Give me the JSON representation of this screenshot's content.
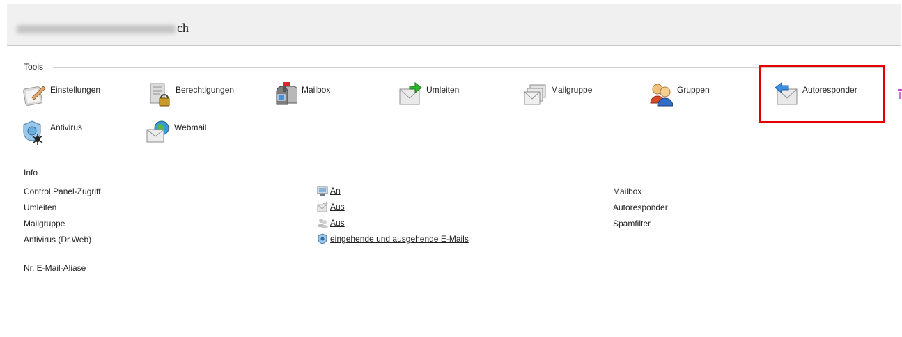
{
  "header": {
    "email_suffix": "ch"
  },
  "tools": {
    "title": "Tools",
    "items": [
      {
        "label": "Einstellungen",
        "icon": "settings-icon"
      },
      {
        "label": "Berechtigungen",
        "icon": "permissions-icon"
      },
      {
        "label": "Mailbox",
        "icon": "mailbox-icon"
      },
      {
        "label": "Umleiten",
        "icon": "forward-mail-icon"
      },
      {
        "label": "Mailgruppe",
        "icon": "mail-group-icon"
      },
      {
        "label": "Gruppen",
        "icon": "groups-icon"
      },
      {
        "label": "Autoresponder",
        "icon": "autoresponder-icon"
      },
      {
        "label": "Antivirus",
        "icon": "antivirus-icon"
      },
      {
        "label": "Webmail",
        "icon": "webmail-icon"
      }
    ]
  },
  "info": {
    "title": "Info",
    "labels": [
      "Control Panel-Zugriff",
      "Umleiten",
      "Mailgruppe",
      "Antivirus (Dr.Web)",
      "Nr. E-Mail-Aliase"
    ],
    "values": [
      "An",
      "Aus",
      "Aus",
      "eingehende und ausgehende E-Mails"
    ],
    "right_items": [
      "Mailbox",
      "Autoresponder",
      "Spamfilter"
    ]
  },
  "colors": {
    "highlight": "#e40000",
    "forward_arrow": "#2fb52f"
  }
}
